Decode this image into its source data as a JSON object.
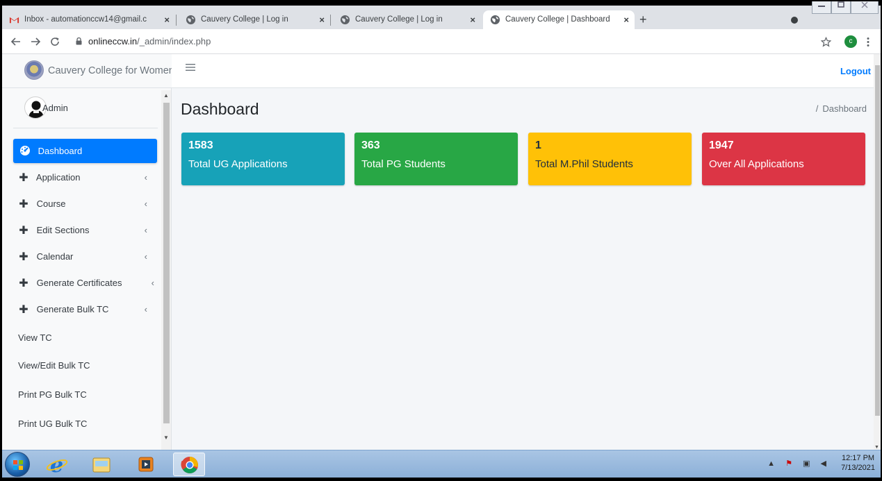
{
  "browser": {
    "tabs": [
      {
        "title": "Inbox - automationccw14@gmail.c",
        "icon": "gmail-icon",
        "active": false
      },
      {
        "title": "Cauvery College | Log in",
        "icon": "globe-icon",
        "active": false
      },
      {
        "title": "Cauvery College | Log in",
        "icon": "globe-icon",
        "active": false
      },
      {
        "title": "Cauvery College | Dashboard",
        "icon": "globe-icon",
        "active": true
      }
    ],
    "close_glyph": "×",
    "new_tab_glyph": "+",
    "url_host": "onlineccw.in",
    "url_path": "/_admin/index.php",
    "profile_initial": "c"
  },
  "sidebar": {
    "brand": "Cauvery College for Women",
    "user": "Admin",
    "items": [
      {
        "label": "Dashboard",
        "icon": "tachometer-icon",
        "active": true,
        "has_submenu": false
      },
      {
        "label": "Application",
        "icon": "plus-icon",
        "active": false,
        "has_submenu": true
      },
      {
        "label": "Course",
        "icon": "plus-icon",
        "active": false,
        "has_submenu": true
      },
      {
        "label": "Edit Sections",
        "icon": "plus-icon",
        "active": false,
        "has_submenu": true
      },
      {
        "label": "Calendar",
        "icon": "plus-icon",
        "active": false,
        "has_submenu": true
      },
      {
        "label": "Generate Certificates",
        "icon": "plus-icon",
        "active": false,
        "has_submenu": true
      },
      {
        "label": "Generate Bulk TC",
        "icon": "plus-icon",
        "active": false,
        "has_submenu": true
      },
      {
        "label": "View TC",
        "icon": "",
        "active": false,
        "has_submenu": false
      },
      {
        "label": "View/Edit Bulk TC",
        "icon": "",
        "active": false,
        "has_submenu": false
      },
      {
        "label": "Print PG Bulk TC",
        "icon": "",
        "active": false,
        "has_submenu": false
      },
      {
        "label": "Print UG Bulk TC",
        "icon": "",
        "active": false,
        "has_submenu": false
      }
    ]
  },
  "topnav": {
    "logout_label": "Logout"
  },
  "content": {
    "title": "Dashboard",
    "breadcrumb_sep": "/",
    "breadcrumb": "Dashboard",
    "cards": [
      {
        "value": "1583",
        "label": "Total UG Applications",
        "color": "#17a2b8"
      },
      {
        "value": "363",
        "label": "Total PG Students",
        "color": "#28a745"
      },
      {
        "value": "1",
        "label": "Total M.Phil Students",
        "color": "#ffc107"
      },
      {
        "value": "1947",
        "label": "Over All Applications",
        "color": "#dc3545"
      }
    ]
  },
  "taskbar": {
    "time": "12:17 PM",
    "date": "7/13/2021"
  }
}
